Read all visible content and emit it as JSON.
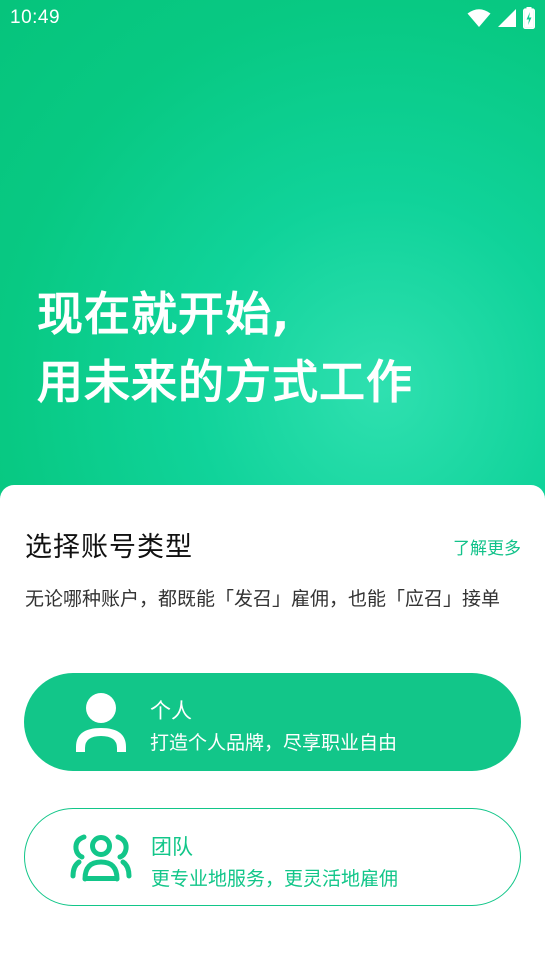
{
  "status_bar": {
    "time": "10:49"
  },
  "hero": {
    "line1": "现在就开始,",
    "line2": "用未来的方式工作"
  },
  "sheet": {
    "title": "选择账号类型",
    "learn_more": "了解更多",
    "description": "无论哪种账户，都既能「发召」雇佣，也能「应召」接单"
  },
  "options": {
    "personal": {
      "title": "个人",
      "subtitle": "打造个人品牌，尽享职业自由",
      "icon": "person-icon"
    },
    "team": {
      "title": "团队",
      "subtitle": "更专业地服务，更灵活地雇佣",
      "icon": "team-icon"
    }
  },
  "colors": {
    "brand_green": "#12c689",
    "hero_gradient_light": "#2fe0b0",
    "hero_gradient_dark": "#06c47c"
  }
}
